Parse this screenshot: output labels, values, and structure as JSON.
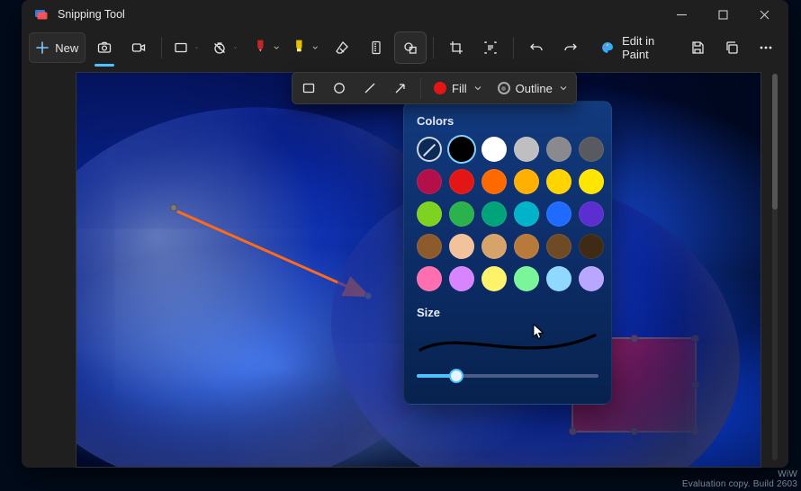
{
  "window": {
    "title": "Snipping Tool"
  },
  "toolbar": {
    "new_label": "New",
    "edit_in_paint_label": "Edit in Paint"
  },
  "shape_strip": {
    "fill_label": "Fill",
    "outline_label": "Outline",
    "fill_color": "#e31515"
  },
  "popover": {
    "colors_heading": "Colors",
    "size_heading": "Size",
    "selected_index": 1,
    "swatches": [
      "none",
      "#000000",
      "#ffffff",
      "#bfbfc2",
      "#8a8a8e",
      "#595960",
      "#b3104a",
      "#e31515",
      "#ff6a00",
      "#ffb000",
      "#ffd400",
      "#ffe600",
      "#7ed321",
      "#2bb24c",
      "#00a37a",
      "#00b3c8",
      "#1f6bff",
      "#5b2ed0",
      "#8d5a2b",
      "#f2c29b",
      "#d6a46a",
      "#b87a3a",
      "#6f4b25",
      "#3e2a15",
      "#ff6fb0",
      "#d884ff",
      "#fff26b",
      "#7af59a",
      "#8fd8ff",
      "#b8a6ff"
    ],
    "size_value_percent": 22
  },
  "watermark": {
    "line1": "WiW",
    "line2": "Evaluation copy. Build 2603"
  }
}
